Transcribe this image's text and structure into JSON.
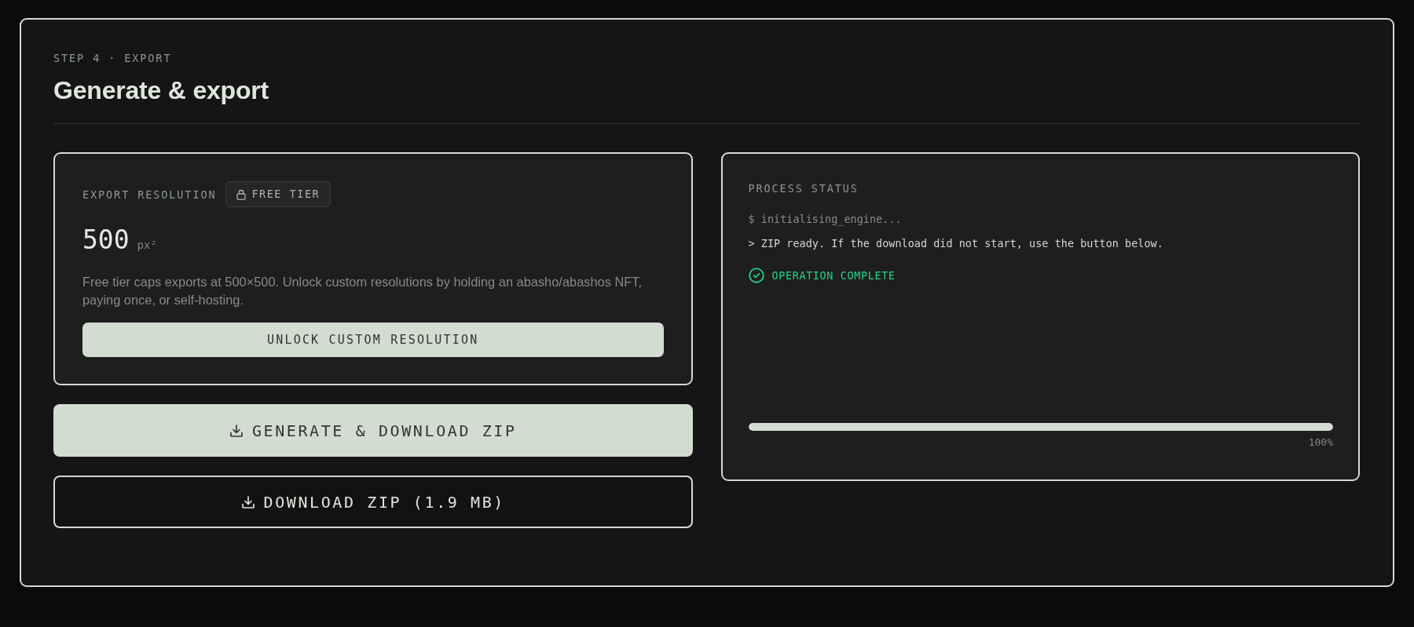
{
  "header": {
    "eyebrow": "STEP 4 · EXPORT",
    "title": "Generate & export"
  },
  "resolution_card": {
    "label": "EXPORT RESOLUTION",
    "badge": "FREE TIER",
    "value": "500",
    "unit": "px²",
    "description": "Free tier caps exports at 500×500. Unlock custom resolutions by holding an abasho/abashos NFT, paying once, or self-hosting.",
    "button": "UNLOCK CUSTOM RESOLUTION"
  },
  "actions": [
    {
      "label": "GENERATE & DOWNLOAD ZIP",
      "kind": "primary"
    },
    {
      "label": "DOWNLOAD ZIP (1.9 MB)",
      "kind": "outline"
    }
  ],
  "status_card": {
    "title": "PROCESS STATUS",
    "log": [
      {
        "text": "$ initialising_engine...",
        "kind": "command"
      },
      {
        "text": "> ZIP ready. If the download did not start, use the button below.",
        "kind": "output"
      },
      {
        "text": "OPERATION COMPLETE",
        "kind": "success"
      }
    ],
    "progress": {
      "level": 1,
      "reading": "100%"
    }
  }
}
